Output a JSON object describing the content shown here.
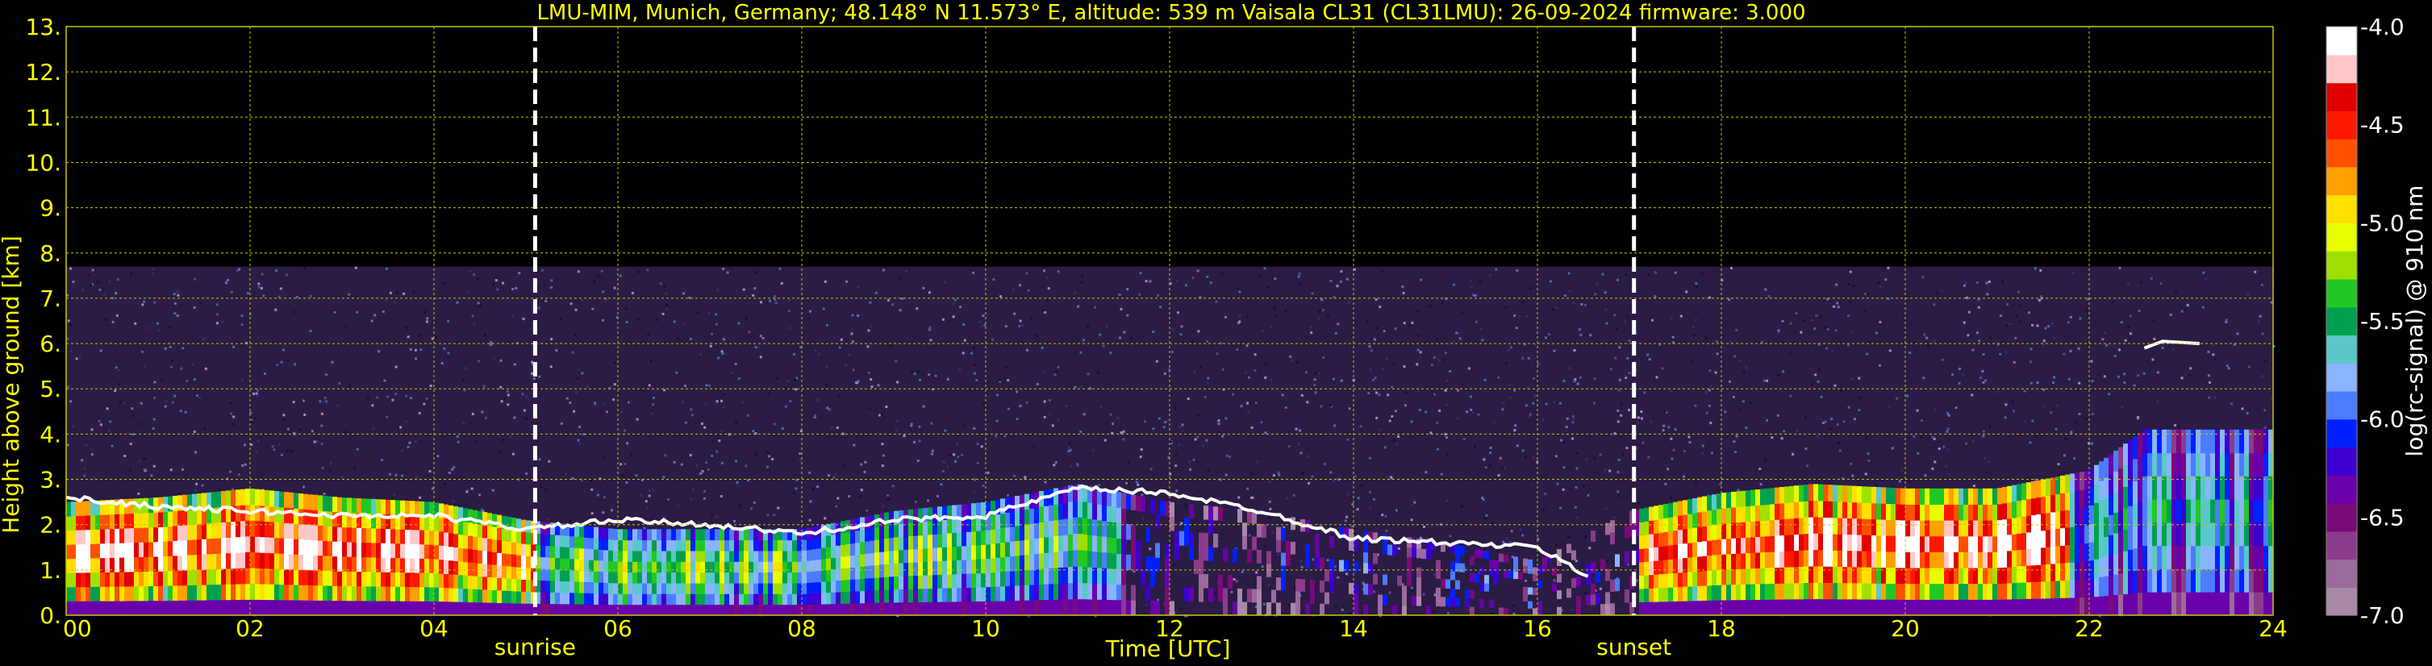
{
  "chart_data": {
    "type": "heatmap",
    "title": "LMU-MIM, Munich, Germany; 48.148° N 11.573° E, altitude: 539 m    Vaisala CL31 (CL31LMU): 26-09-2024    firmware: 3.000",
    "xlabel": "Time [UTC]",
    "ylabel": "Height above ground [km]",
    "xlim": [
      0,
      24
    ],
    "ylim": [
      0,
      13
    ],
    "x_ticks": [
      "00",
      "02",
      "04",
      "06",
      "08",
      "10",
      "12",
      "14",
      "16",
      "18",
      "20",
      "22",
      "24"
    ],
    "y_ticks": [
      "0.",
      "1.",
      "2.",
      "3.",
      "4.",
      "5.",
      "6.",
      "7.",
      "8.",
      "9.",
      "10.",
      "11.",
      "12.",
      "13."
    ],
    "grid": true,
    "measurement_top_km": 7.7,
    "events": [
      {
        "label": "sunrise",
        "time_h": 5.1
      },
      {
        "label": "sunset",
        "time_h": 17.05
      }
    ],
    "colorbar": {
      "label": "log(rc-signal) @ 910 nm",
      "range": [
        -7.0,
        -4.0
      ],
      "ticks": [
        "-4.0",
        "-4.5",
        "-5.0",
        "-5.5",
        "-6.0",
        "-6.5",
        "-7.0"
      ],
      "palette": [
        "#a88aa8",
        "#9c6a9c",
        "#8a3c8a",
        "#7a0a7a",
        "#6a00aa",
        "#3c00d0",
        "#0020ff",
        "#4c7cff",
        "#8ab4ff",
        "#5ac8c8",
        "#00a050",
        "#22c822",
        "#a0e000",
        "#e8ff00",
        "#ffe000",
        "#ffa000",
        "#ff5000",
        "#ff1800",
        "#e00000",
        "#ffc8c8",
        "#ffffff"
      ]
    },
    "aerosol_layer_top_km": [
      [
        0,
        2.5
      ],
      [
        1,
        2.6
      ],
      [
        2,
        2.8
      ],
      [
        3,
        2.6
      ],
      [
        4,
        2.5
      ],
      [
        5,
        2.1
      ],
      [
        6,
        1.9
      ],
      [
        7,
        1.9
      ],
      [
        8,
        1.9
      ],
      [
        9,
        2.3
      ],
      [
        10,
        2.5
      ],
      [
        11,
        2.9
      ],
      [
        12,
        2.5
      ],
      [
        13,
        2.3
      ],
      [
        14,
        1.9
      ],
      [
        15,
        1.6
      ],
      [
        16,
        1.2
      ],
      [
        17,
        2.3
      ],
      [
        18,
        2.7
      ],
      [
        19,
        2.9
      ],
      [
        20,
        2.8
      ],
      [
        21,
        2.8
      ],
      [
        22,
        3.2
      ],
      [
        22.6,
        4.1
      ]
    ],
    "cloud_echo_km": [
      [
        0,
        2.6
      ],
      [
        1,
        2.4
      ],
      [
        2,
        2.3
      ],
      [
        3,
        2.2
      ],
      [
        4,
        2.2
      ],
      [
        5,
        1.9
      ],
      [
        6,
        2.1
      ],
      [
        7,
        2.0
      ],
      [
        8,
        1.8
      ],
      [
        9,
        2.1
      ],
      [
        10,
        2.2
      ],
      [
        11,
        2.8
      ],
      [
        12,
        2.7
      ],
      [
        13,
        2.3
      ],
      [
        14,
        1.7
      ],
      [
        15,
        1.6
      ],
      [
        16,
        1.5
      ],
      [
        16.6,
        0.8
      ]
    ]
  }
}
